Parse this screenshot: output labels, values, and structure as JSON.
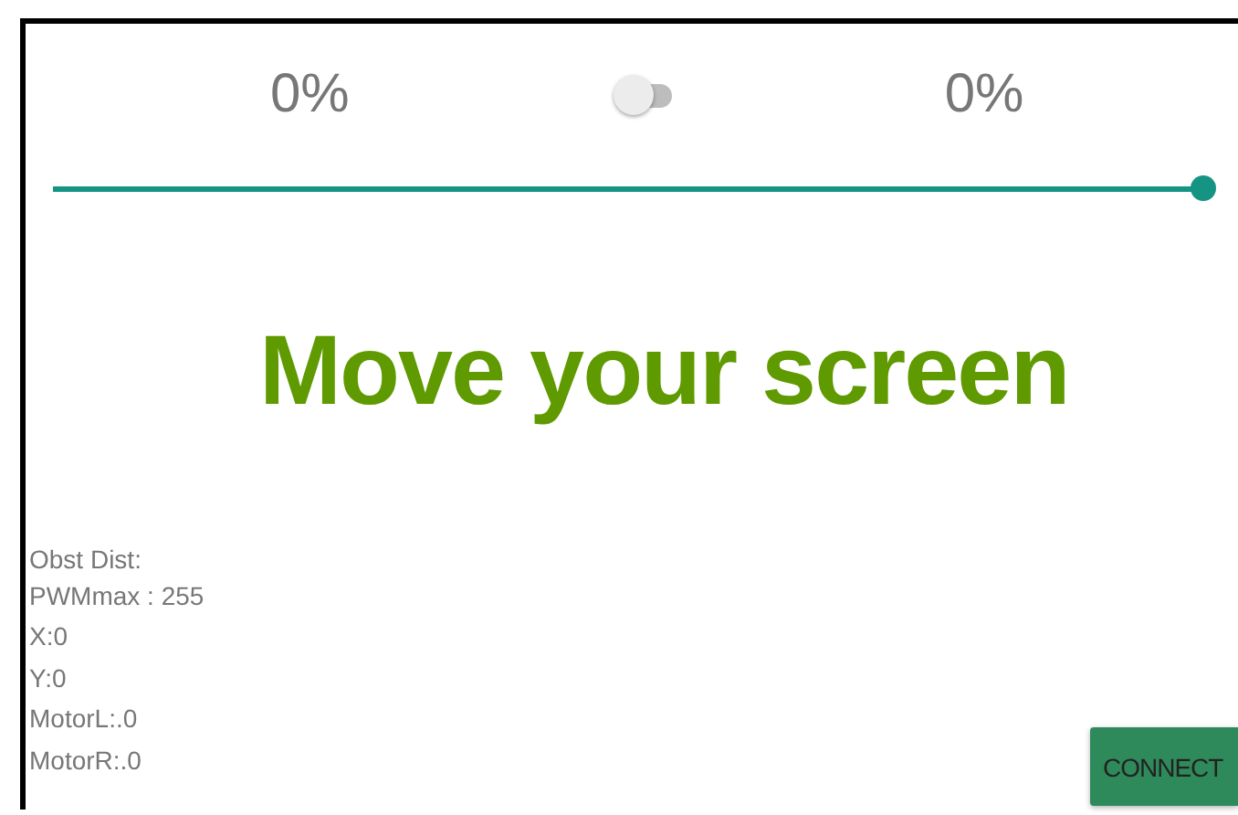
{
  "left_speed": "0%",
  "mode_switch": {
    "on": false
  },
  "right_speed": "0%",
  "slider": {
    "level": 1
  },
  "prompt": "Move your screen",
  "readings": [
    "Obst Dist:",
    "PWMmax : 255",
    "X:0",
    "Y:0",
    "MotorL:.0",
    "MotorR:.0"
  ],
  "connect_button": "CONNECT"
}
